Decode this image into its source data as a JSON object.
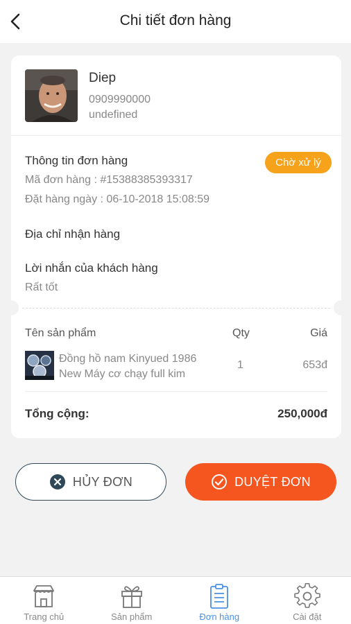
{
  "header": {
    "title": "Chi tiết đơn hàng",
    "back_icon": "chevron-left-icon"
  },
  "customer": {
    "name": "Diep",
    "phone": "0909990000",
    "extra": "undefined"
  },
  "order": {
    "section_title": "Thông tin đơn hàng",
    "status": "Chờ xử lý",
    "status_color": "#f7a21b",
    "code": "Mã đơn hàng : #15388385393317",
    "date": "Đặt hàng ngày : 06-10-2018 15:08:59",
    "address_title": "Địa chỉ nhận hàng",
    "message_title": "Lời nhắn của khách hàng",
    "message": "Rất tốt"
  },
  "products": {
    "headers": {
      "name": "Tên sản phẩm",
      "qty": "Qty",
      "price": "Giá"
    },
    "items": [
      {
        "name_line1": "Đồng hồ nam Kinyued 1986",
        "name_line2": "New Máy cơ chạy full kim",
        "qty": "1",
        "price": "653đ"
      }
    ],
    "total_label": "Tổng cộng:",
    "total_value": "250,000đ"
  },
  "actions": {
    "cancel_label": "HỦY ĐƠN",
    "approve_label": "DUYỆT ĐƠN",
    "approve_color": "#f5551f"
  },
  "tabs": [
    {
      "label": "Trang chủ",
      "icon": "store-icon",
      "active": false
    },
    {
      "label": "Sản phẩm",
      "icon": "gift-icon",
      "active": false
    },
    {
      "label": "Đơn hàng",
      "icon": "clipboard-icon",
      "active": true
    },
    {
      "label": "Cài đặt",
      "icon": "gear-icon",
      "active": false
    }
  ],
  "accent_color": "#4a90e2"
}
